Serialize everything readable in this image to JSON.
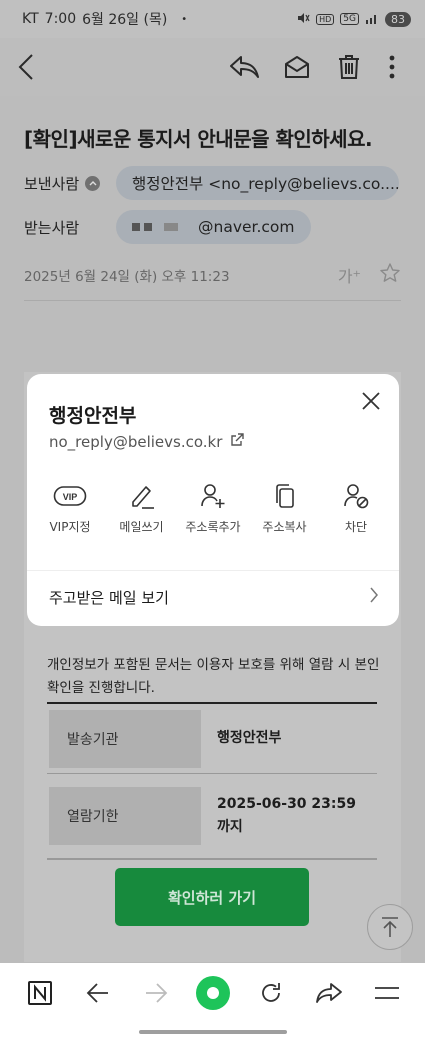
{
  "status_bar": {
    "carrier": "KT",
    "time": "7:00",
    "date": "6월 26일 (목)",
    "dot": "•",
    "network": "5G",
    "battery": "83"
  },
  "toolbar": {
    "icons": [
      "back-icon",
      "reply-icon",
      "envelope-icon",
      "trash-icon",
      "more-icon"
    ]
  },
  "mail": {
    "subject": "[확인]새로운 통지서 안내문을 확인하세요.",
    "sender_label": "보낸사람",
    "sender": "행정안전부 <no_reply@believs.co....",
    "recipient_label": "받는사람",
    "recipient_domain": "@naver.com",
    "date": "2025년 6월 24일 (화) 오후 11:23",
    "translate_label": "가⁺"
  },
  "body": {
    "notice": "개인정보가 포함된 문서는 이용자 보호를 위해 열람 시 본인 확인을 진행합니다.",
    "rows": [
      {
        "key": "발송기관",
        "value": "행정안전부"
      },
      {
        "key": "열람기한",
        "value": "2025-06-30 23:59까지"
      }
    ],
    "button": "확인하러 가기"
  },
  "popup": {
    "name": "행정안전부",
    "email": "no_reply@believs.co.kr",
    "actions": [
      {
        "label": "VIP지정",
        "icon": "vip-icon"
      },
      {
        "label": "메일쓰기",
        "icon": "pencil-icon"
      },
      {
        "label": "주소록추가",
        "icon": "add-contact-icon"
      },
      {
        "label": "주소복사",
        "icon": "copy-icon"
      },
      {
        "label": "차단",
        "icon": "block-user-icon"
      }
    ],
    "link": "주고받은 메일 보기"
  },
  "bottom_nav": {
    "icons": [
      "naver-n-icon",
      "nav-back-icon",
      "nav-forward-icon",
      "green-home-icon",
      "refresh-icon",
      "share-icon",
      "menu-icon"
    ]
  },
  "colors": {
    "accent_green": "#1ec45a",
    "button_green": "#178a3d"
  }
}
